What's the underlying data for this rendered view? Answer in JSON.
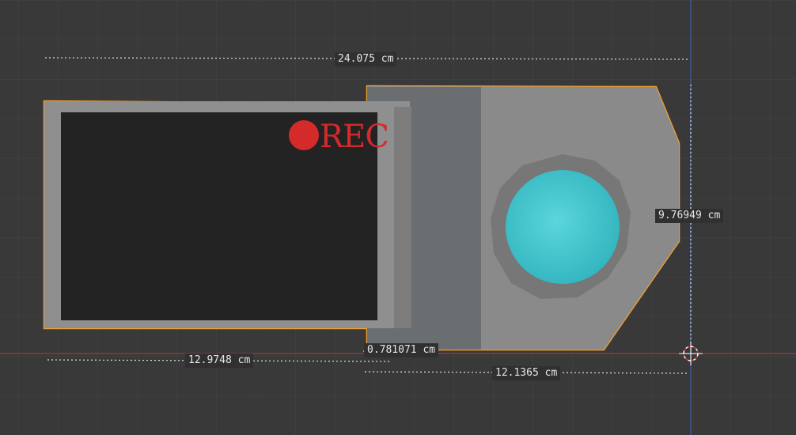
{
  "viewport": {
    "background_color": "#393939",
    "grid_color": "#454545",
    "x_axis_color": "#9b3b3b",
    "y_axis_color": "#3f5d9a",
    "selection_outline_color": "#f0a030"
  },
  "object": {
    "screen_text": "REC",
    "rec_dot_color": "#d42a2a",
    "lens_color": "#45c8d0",
    "screen_color": "#232323",
    "body_color": "#8a8a8a"
  },
  "measurements": {
    "overall_width": "24.075 cm",
    "height": "9.76949 cm",
    "left_section_width": "12.9748 cm",
    "gap": "0.781071 cm",
    "right_section_width": "12.1365 cm"
  }
}
